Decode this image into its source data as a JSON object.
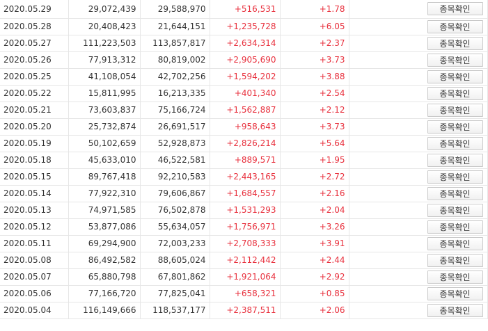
{
  "button_label": "종목확인",
  "colors": {
    "up": "#e8303d",
    "text": "#333333",
    "grid": "#e6e6e6"
  },
  "rows": [
    {
      "date": "2020.05.29",
      "v1": "29,072,439",
      "v2": "29,588,970",
      "change": "+516,531",
      "pct": "+1.78"
    },
    {
      "date": "2020.05.28",
      "v1": "20,408,423",
      "v2": "21,644,151",
      "change": "+1,235,728",
      "pct": "+6.05"
    },
    {
      "date": "2020.05.27",
      "v1": "111,223,503",
      "v2": "113,857,817",
      "change": "+2,634,314",
      "pct": "+2.37"
    },
    {
      "date": "2020.05.26",
      "v1": "77,913,312",
      "v2": "80,819,002",
      "change": "+2,905,690",
      "pct": "+3.73"
    },
    {
      "date": "2020.05.25",
      "v1": "41,108,054",
      "v2": "42,702,256",
      "change": "+1,594,202",
      "pct": "+3.88"
    },
    {
      "date": "2020.05.22",
      "v1": "15,811,995",
      "v2": "16,213,335",
      "change": "+401,340",
      "pct": "+2.54"
    },
    {
      "date": "2020.05.21",
      "v1": "73,603,837",
      "v2": "75,166,724",
      "change": "+1,562,887",
      "pct": "+2.12"
    },
    {
      "date": "2020.05.20",
      "v1": "25,732,874",
      "v2": "26,691,517",
      "change": "+958,643",
      "pct": "+3.73"
    },
    {
      "date": "2020.05.19",
      "v1": "50,102,659",
      "v2": "52,928,873",
      "change": "+2,826,214",
      "pct": "+5.64"
    },
    {
      "date": "2020.05.18",
      "v1": "45,633,010",
      "v2": "46,522,581",
      "change": "+889,571",
      "pct": "+1.95"
    },
    {
      "date": "2020.05.15",
      "v1": "89,767,418",
      "v2": "92,210,583",
      "change": "+2,443,165",
      "pct": "+2.72"
    },
    {
      "date": "2020.05.14",
      "v1": "77,922,310",
      "v2": "79,606,867",
      "change": "+1,684,557",
      "pct": "+2.16"
    },
    {
      "date": "2020.05.13",
      "v1": "74,971,585",
      "v2": "76,502,878",
      "change": "+1,531,293",
      "pct": "+2.04"
    },
    {
      "date": "2020.05.12",
      "v1": "53,877,086",
      "v2": "55,634,057",
      "change": "+1,756,971",
      "pct": "+3.26"
    },
    {
      "date": "2020.05.11",
      "v1": "69,294,900",
      "v2": "72,003,233",
      "change": "+2,708,333",
      "pct": "+3.91"
    },
    {
      "date": "2020.05.08",
      "v1": "86,492,582",
      "v2": "88,605,024",
      "change": "+2,112,442",
      "pct": "+2.44"
    },
    {
      "date": "2020.05.07",
      "v1": "65,880,798",
      "v2": "67,801,862",
      "change": "+1,921,064",
      "pct": "+2.92"
    },
    {
      "date": "2020.05.06",
      "v1": "77,166,720",
      "v2": "77,825,041",
      "change": "+658,321",
      "pct": "+0.85"
    },
    {
      "date": "2020.05.04",
      "v1": "116,149,666",
      "v2": "118,537,177",
      "change": "+2,387,511",
      "pct": "+2.06"
    }
  ]
}
